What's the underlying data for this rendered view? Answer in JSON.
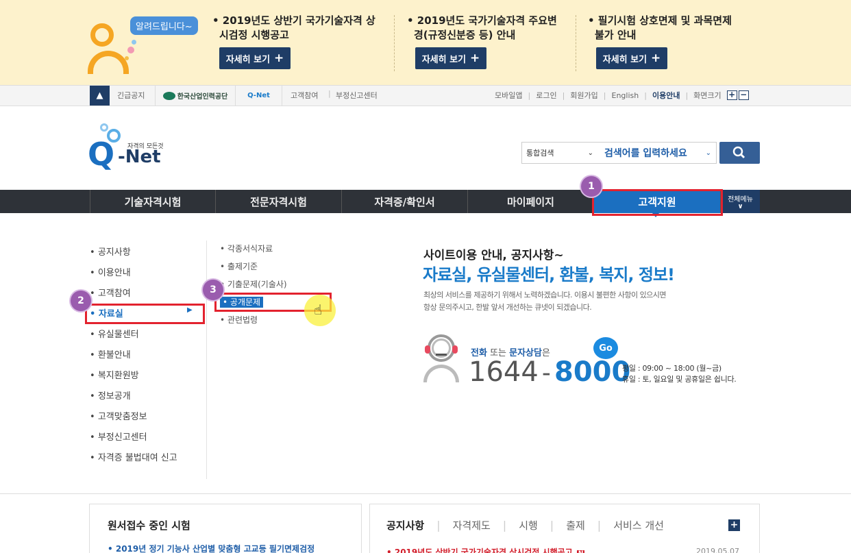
{
  "banner": {
    "mascot_bubble": "알려드립니다~",
    "notices": [
      {
        "line1": "• 2019년도 상반기 국가기술자격 상",
        "line2": "시검정 시행공고",
        "button": "자세히 보기"
      },
      {
        "line1": "• 2019년도 국가기술자격 주요변",
        "line2": "경(규정신분증 등) 안내",
        "button": "자세히 보기"
      },
      {
        "line1": "• 필기시험 상호면제 및 과목면제",
        "line2": "불가 안내",
        "button": "자세히 보기"
      }
    ]
  },
  "util": {
    "left": [
      "긴급공지",
      "한국산업인력공단",
      "Q-Net",
      "고객참여",
      "부정신고센터"
    ],
    "right": [
      "모바일앱",
      "로그인",
      "회원가입",
      "English",
      "이용안내",
      "화면크기"
    ],
    "zoom_plus": "+",
    "zoom_minus": "−"
  },
  "logo": {
    "tagline": "자격의 모든것",
    "name": "Q-Net",
    "q": "Q"
  },
  "search": {
    "scope": "통합검색",
    "placeholder": "검색어를 입력하세요"
  },
  "gnb": {
    "items": [
      "기술자격시험",
      "전문자격시험",
      "자격증/확인서",
      "마이페이지",
      "고객지원"
    ],
    "all_menu": "전체메뉴"
  },
  "menu_level1": [
    "공지사항",
    "이용안내",
    "고객참여",
    "자료실",
    "유실물센터",
    "환불안내",
    "복지환원방",
    "정보공개",
    "고객맞춤정보",
    "부정신고센터",
    "자격증 불법대여 신고"
  ],
  "menu_level2": [
    "각종서식자료",
    "출제기준",
    "기출문제(기술사)",
    "공개문제",
    "관련법령"
  ],
  "badges": [
    "1",
    "2",
    "3"
  ],
  "promo": {
    "heading": "사이트이용 안내, 공지사항~",
    "headline": "자료실, 유실물센터, 환불, 복지, 정보!",
    "desc1": "최상의 서비스를 제공하기 위해서 노력하겠습니다. 이용시 불편한 사항이 있으시면",
    "desc2": "항상 문의주시고, 한발 앞서 개선하는 큐넷이 되겠습니다.",
    "contact_phone": "전화",
    "contact_or": "또는",
    "contact_sms": "문자상담",
    "contact_suffix": "은",
    "go": "Go",
    "phone_a": "1644",
    "phone_dash": "-",
    "phone_b": "8000",
    "weekday": "평일 : 09:00 ~ 18:00 (월~금)",
    "holiday": "휴일 : 토, 일요일 및 공휴일은 쉽니다."
  },
  "bottom_left": {
    "title": "원서접수 중인 시험",
    "item": "• 2019년 정기 기능사 산업별 맞춤형 고교등 필기면제검정"
  },
  "bottom_right": {
    "tabs": [
      "공지사항",
      "자격제도",
      "시행",
      "출제",
      "서비스 개선"
    ],
    "item": "• 2019년도 상반기 국가기술자격 상시검정 시행공고",
    "new_badge": "N",
    "date": "2019.05.07"
  },
  "colors": {
    "accent_blue": "#1a7bc9",
    "navy": "#1f3d66",
    "highlight_red": "#e3222e",
    "badge_purple": "#9a5cae"
  }
}
